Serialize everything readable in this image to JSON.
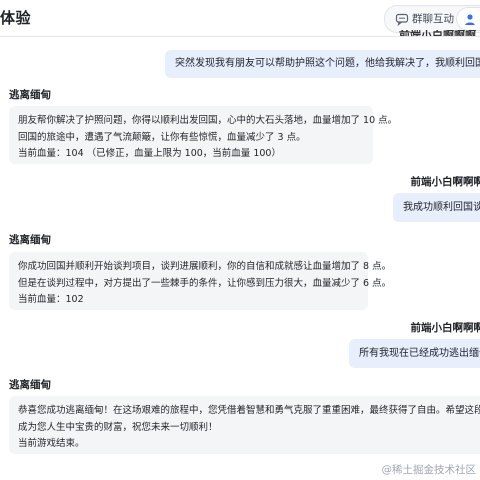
{
  "header": {
    "title": "体验",
    "modes": [
      {
        "label": "群聊互动",
        "icon": "group-chat-icon"
      },
      {
        "label": "单",
        "icon": "person-icon"
      }
    ]
  },
  "clipped_top_text": "前端小白啊啊啊",
  "messages": [
    {
      "role": "user",
      "text": "突然发现我有朋友可以帮助护照这个问题，他给我解决了，我顺利回国谈判项目"
    },
    {
      "role": "bot",
      "sender": "逃离缅甸",
      "lines": [
        "朋友帮你解决了护照问题，你得以顺利出发回国，心中的大石头落地，血量增加了 10 点。",
        "回国的旅途中，遭遇了气流颠簸，让你有些惊慌，血量减少了 3 点。",
        "当前血量：104 （已修正，血量上限为 100，当前血量 100）"
      ]
    },
    {
      "role": "user",
      "sender": "前端小白啊啊啊",
      "text": "我成功顺利回国谈判"
    },
    {
      "role": "bot",
      "sender": "逃离缅甸",
      "lines": [
        "你成功回国并顺利开始谈判项目，谈判进展顺利，你的自信和成就感让血量增加了 8 点。",
        "但是在谈判过程中，对方提出了一些棘手的条件，让你感到压力很大，血量减少了 6 点。",
        "当前血量：102"
      ]
    },
    {
      "role": "user",
      "sender": "前端小白啊啊啊",
      "text": "所有我现在已经成功逃出缅甸了"
    },
    {
      "role": "bot",
      "sender": "逃离缅甸",
      "lines": [
        "恭喜您成功逃离缅甸！在这场艰难的旅程中，您凭借着智慧和勇气克服了重重困难，最终获得了自由。希望这段经历能",
        "成为您人生中宝贵的财富，祝您未来一切顺利！",
        "当前游戏结束。"
      ]
    }
  ],
  "watermark": "@稀土掘金技术社区",
  "colors": {
    "user_bubble": "#e7eefc",
    "bot_bubble": "#f4f5f7",
    "accent": "#3b6ef5"
  }
}
